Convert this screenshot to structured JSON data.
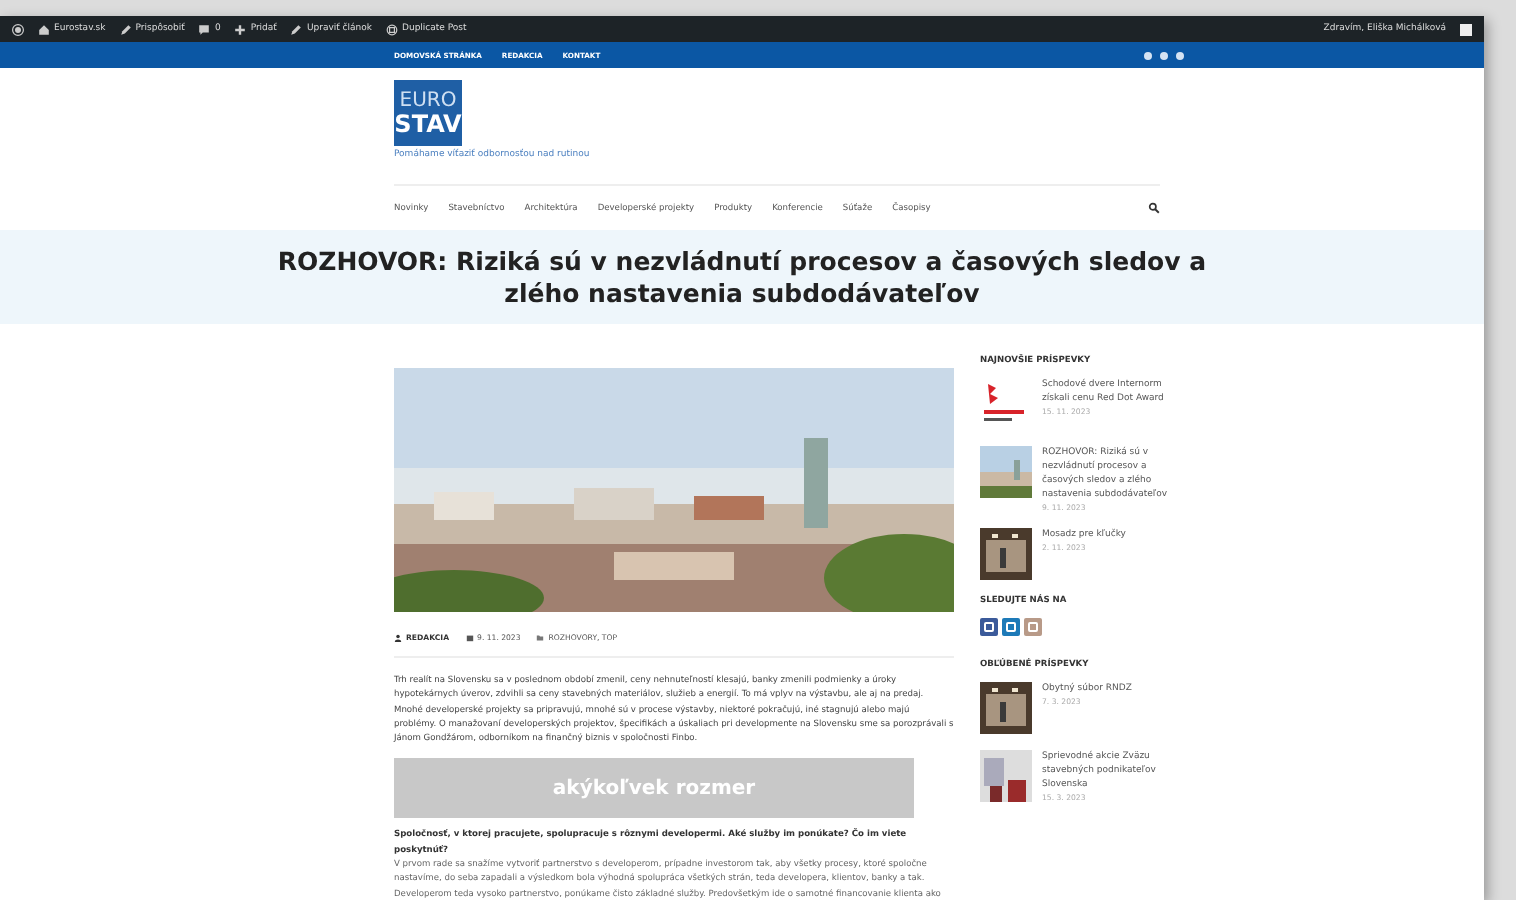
{
  "admin_bar": {
    "items": [
      {
        "kind": "wp"
      },
      {
        "kind": "home",
        "label": "Eurostav.sk"
      },
      {
        "kind": "edit",
        "label": "Prispôsobiť"
      },
      {
        "kind": "comment",
        "label": "0"
      },
      {
        "kind": "plus",
        "label": "Pridať"
      },
      {
        "kind": "edit",
        "label": "Upraviť článok"
      },
      {
        "kind": "copy",
        "label": "Duplicate Post"
      }
    ],
    "greeting": "Zdravím, Eliška Michálková"
  },
  "top_nav": {
    "links": [
      "DOMOVSKÁ STRÁNKA",
      "REDAKCIA",
      "KONTAKT"
    ]
  },
  "logo": {
    "line_1": "EURO",
    "line_2": "STAV",
    "tagline": "Pomáhame víťaziť odbornosťou nad rutinou"
  },
  "menu": [
    "Novinky",
    "Stavebníctvo",
    "Architektúra",
    "Developerské projekty",
    "Produkty",
    "Konferencie",
    "Súťaže",
    "Časopisy"
  ],
  "title": "ROZHOVOR: Riziká sú v nezvládnutí procesov a časových sledov a zlého nastavenia subdodávateľov",
  "article": {
    "author": "REDAKCIA",
    "date": "9. 11. 2023",
    "categories": "ROZHOVORY, TOP",
    "lead": "Trh realít na Slovensku sa v poslednom období zmenil, ceny nehnuteľností klesajú, banky zmenili podmienky a úroky hypotekárnych úverov, zdvihli sa ceny stavebných materiálov, služieb a energií. To má vplyv na výstavbu, ale aj na predaj. Mnohé developerské projekty sa pripravujú, mnohé sú v procese výstavby, niektoré pokračujú, iné stagnujú alebo majú problémy. O manažovaní developerských projektov, špecifikách a úskaliach pri developmente na Slovensku sme sa porozprávali s Jánom Gondžárom, odborníkom na finančný biznis v spoločnosti Finbo.",
    "ad": "akýkoľvek rozmer",
    "question": "Spoločnosť, v ktorej pracujete, spolupracuje s rôznymi developermi. Aké služby im ponúkate? Čo im viete poskytnúť?",
    "answer": "V prvom rade sa snažíme vytvoriť partnerstvo s developerom, prípadne investorom tak, aby všetky procesy, ktoré spoločne nastavíme, do seba zapadali a výsledkom bola výhodná spolupráca všetkých strán, teda developera, klientov, banky a tak. Developerom teda vysoko partnerstvo, ponúkame čisto základné služby. Predovšetkým ide o samotné financovanie klienta ako"
  },
  "sidebar": {
    "sections": [
      {
        "kind": "posts",
        "heading": "NAJNOVŠIE PRÍSPEVKY",
        "posts": [
          {
            "title": "Schodové dvere Internorm získali cenu Red Dot Award",
            "date": "15. 11. 2023"
          },
          {
            "title": "ROZHOVOR: Riziká sú v nezvládnutí procesov a časových sledov a zlého nastavenia subdodávateľov",
            "date": "9. 11. 2023"
          },
          {
            "title": "Mosadz pre kľučky",
            "date": "2. 11. 2023"
          }
        ]
      },
      {
        "kind": "social",
        "heading": "SLEDUJTE NÁS NA",
        "icons": [
          {
            "color": "#3b5a9a"
          },
          {
            "color": "#1d7ab8"
          },
          {
            "color": "#b89a88"
          }
        ]
      },
      {
        "kind": "posts",
        "heading": "OBĽÚBENÉ PRÍSPEVKY",
        "posts": [
          {
            "title": "Obytný súbor RNDZ",
            "date": "7. 3. 2023"
          },
          {
            "title": "Sprievodné akcie Zväzu stavebných podnikateľov Slovenska",
            "date": "15. 3. 2023"
          }
        ]
      }
    ]
  }
}
